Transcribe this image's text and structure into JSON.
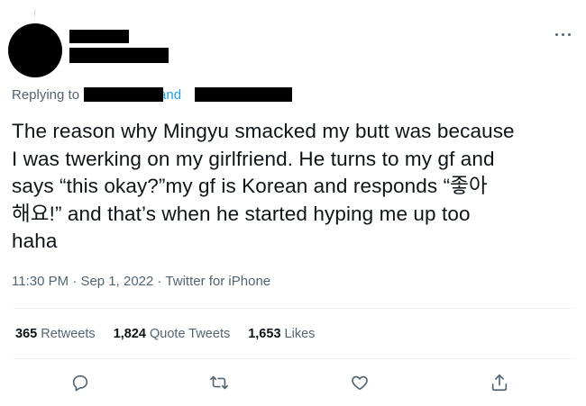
{
  "tweet": {
    "replying_prefix": "Replying to",
    "replying_and": "and",
    "text": "The reason why Mingyu smacked my butt was because\nI was twerking on my girlfriend. He turns to my gf and\nsays “this okay?”my gf is Korean and responds “좋아\n해요!” and that’s when he started hyping me up too\nhaha",
    "time": "11:30 PM",
    "date": "Sep 1, 2022",
    "source": "Twitter for iPhone",
    "meta_sep": " · "
  },
  "stats": {
    "retweets_count": "365",
    "retweets_label": "Retweets",
    "quotes_count": "1,824",
    "quotes_label": "Quote Tweets",
    "likes_count": "1,653",
    "likes_label": "Likes"
  },
  "icons": {
    "more": "more-horizontal-icon",
    "reply": "reply-icon",
    "retweet": "retweet-icon",
    "like": "heart-icon",
    "share": "share-icon"
  },
  "colors": {
    "text": "#0f1419",
    "muted": "#536471",
    "link": "#1d9bf0",
    "divider": "#eff3f4",
    "redaction": "#000000"
  }
}
